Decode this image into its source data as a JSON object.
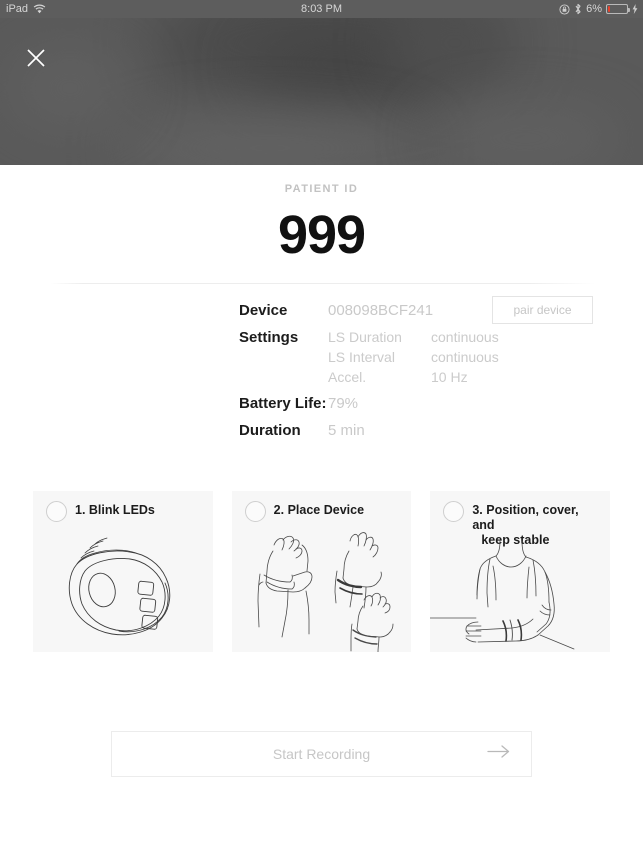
{
  "statusbar": {
    "device": "iPad",
    "wifi_icon": "wifi-icon",
    "time": "8:03 PM",
    "rotation_lock_icon": "rotation-lock-icon",
    "bluetooth_icon": "bluetooth-icon",
    "battery_percent": "6%",
    "battery_level": 6,
    "battery_color": "#e8402a",
    "charging_icon": "charging-bolt-icon"
  },
  "overlay": {
    "close_icon": "close-icon",
    "backdrop_color": "#5a5a5a"
  },
  "header": {
    "patient_label": "PATIENT ID",
    "patient_id": "999"
  },
  "details": {
    "device": {
      "label": "Device",
      "value": "008098BCF241",
      "pair_button": "pair device"
    },
    "settings": {
      "label": "Settings",
      "rows": [
        {
          "name": "LS Duration",
          "value": "continuous"
        },
        {
          "name": "LS Interval",
          "value": "continuous"
        },
        {
          "name": "Accel.",
          "value": "10 Hz"
        }
      ]
    },
    "battery": {
      "label": "Battery Life:",
      "value": "79%"
    },
    "duration": {
      "label": "Duration",
      "value": "5 min"
    }
  },
  "instructions": [
    {
      "title": "1. Blink LEDs",
      "title_line2": "",
      "illustration": "wristband-device-illustration"
    },
    {
      "title": "2. Place Device",
      "title_line2": "",
      "illustration": "hands-placing-band-illustration"
    },
    {
      "title": "3. Position, cover, and",
      "title_line2": "keep stable",
      "illustration": "person-arm-on-table-illustration"
    }
  ],
  "footer": {
    "start_label": "Start Recording",
    "arrow_icon": "arrow-right-icon"
  }
}
